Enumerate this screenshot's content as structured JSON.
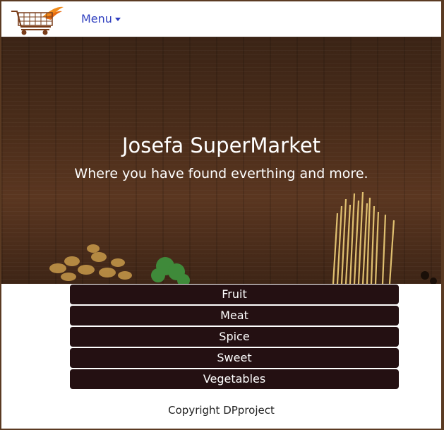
{
  "navbar": {
    "logo_icon": "shopping-cart-icon",
    "menu_label": "Menu",
    "menu_icon": "caret-down-icon"
  },
  "hero": {
    "title": "Josefa SuperMarket",
    "subtitle": "Where you have found everthing and more."
  },
  "categories": [
    "Fruit",
    "Meat",
    "Spice",
    "Sweet",
    "Vegetables"
  ],
  "footer": {
    "copyright": "Copyright DPproject"
  },
  "colors": {
    "accent_link": "#2f3fbf",
    "button_bg": "#241012",
    "logo_orange": "#f08a1a"
  }
}
